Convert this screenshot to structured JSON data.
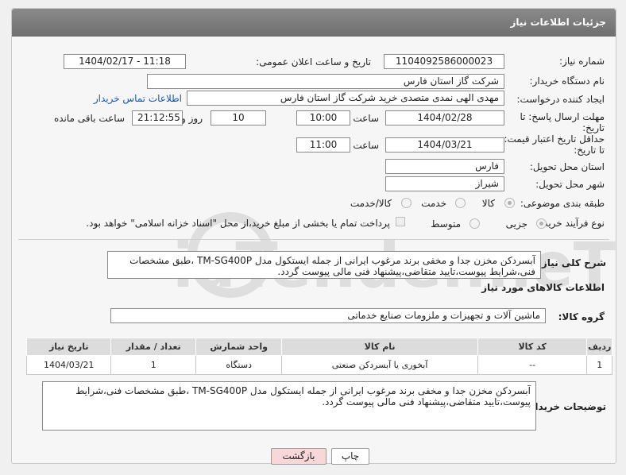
{
  "header": {
    "title": "جزئیات اطلاعات نیاز"
  },
  "fields": {
    "need_number_label": "شماره نیاز:",
    "need_number": "1104092586000023",
    "announce_label": "تاریخ و ساعت اعلان عمومی:",
    "announce_value": "1404/02/17 - 11:18",
    "buyer_org_label": "نام دستگاه خریدار:",
    "buyer_org": "شرکت گاز استان فارس",
    "creator_label": "ایجاد کننده درخواست:",
    "creator": "مهدی الهی نمدی متصدی خرید شرکت گاز استان فارس",
    "contact_link": "اطلاعات تماس خریدار",
    "deadline_label_1": "مهلت ارسال پاسخ: تا",
    "deadline_label_2": "تاریخ:",
    "deadline_date": "1404/02/28",
    "time_label": "ساعت",
    "deadline_time": "10:00",
    "days_value": "10",
    "days_label": "روز و",
    "remaining_time": "21:12:55",
    "remaining_label": "ساعت باقی مانده",
    "min_price_label_1": "حداقل تاریخ اعتبار قیمت:",
    "min_price_label_2": "تا تاریخ:",
    "price_date": "1404/03/21",
    "price_time_label": "ساعت",
    "price_time": "11:00",
    "province_label": "استان محل تحویل:",
    "province": "فارس",
    "city_label": "شهر محل تحویل:",
    "city": "شیراز",
    "category_label": "طبقه بندی موضوعی:",
    "category_options": [
      "کالا",
      "خدمت",
      "کالا/خدمت"
    ],
    "process_label": "نوع فرآیند خرید :",
    "process_options": [
      "جزیی",
      "متوسط"
    ],
    "payment_note": "پرداخت تمام یا بخشی از مبلغ خرید،از محل \"اسناد خزانه اسلامی\" خواهد بود."
  },
  "description": {
    "label": "شرح کلی نیاز:",
    "text": "آبسردکن مخزن جدا و مخفی برند مرغوب ایرانی از جمله ایستکول مدل TM-SG400P ،طبق مشخصات فنی،شرایط پیوست،تایید متقاضی،پیشنهاد فنی مالی پیوست گردد."
  },
  "goods": {
    "section_title": "اطلاعات کالاهای مورد نیاز",
    "group_label": "گروه کالا:",
    "group_value": "ماشین آلات و تجهیزات و ملزومات صنایع خدماتی",
    "columns": [
      "ردیف",
      "کد کالا",
      "نام کالا",
      "واحد شمارش",
      "تعداد / مقدار",
      "تاریخ نیاز"
    ],
    "rows": [
      [
        "1",
        "--",
        "آبخوری یا آبسردکن صنعتی",
        "دستگاه",
        "1",
        "1404/03/21"
      ]
    ]
  },
  "buyer_notes": {
    "label": "توضیحات خریدار:",
    "text": "آبسردکن مخزن جدا و مخفی برند مرغوب ایرانی از جمله ایستکول مدل TM-SG400P ،طبق مشخصات فنی،شرایط پیوست،تایید متقاضی،پیشنهاد فنی مالی پیوست گردد."
  },
  "buttons": {
    "print": "چاپ",
    "back": "بازگشت"
  },
  "watermark": {
    "text": "AriaTender.neT"
  },
  "colors": {
    "header": "#7a7a7a",
    "link": "#1a56a8",
    "back_button": "#f7d7d7"
  }
}
